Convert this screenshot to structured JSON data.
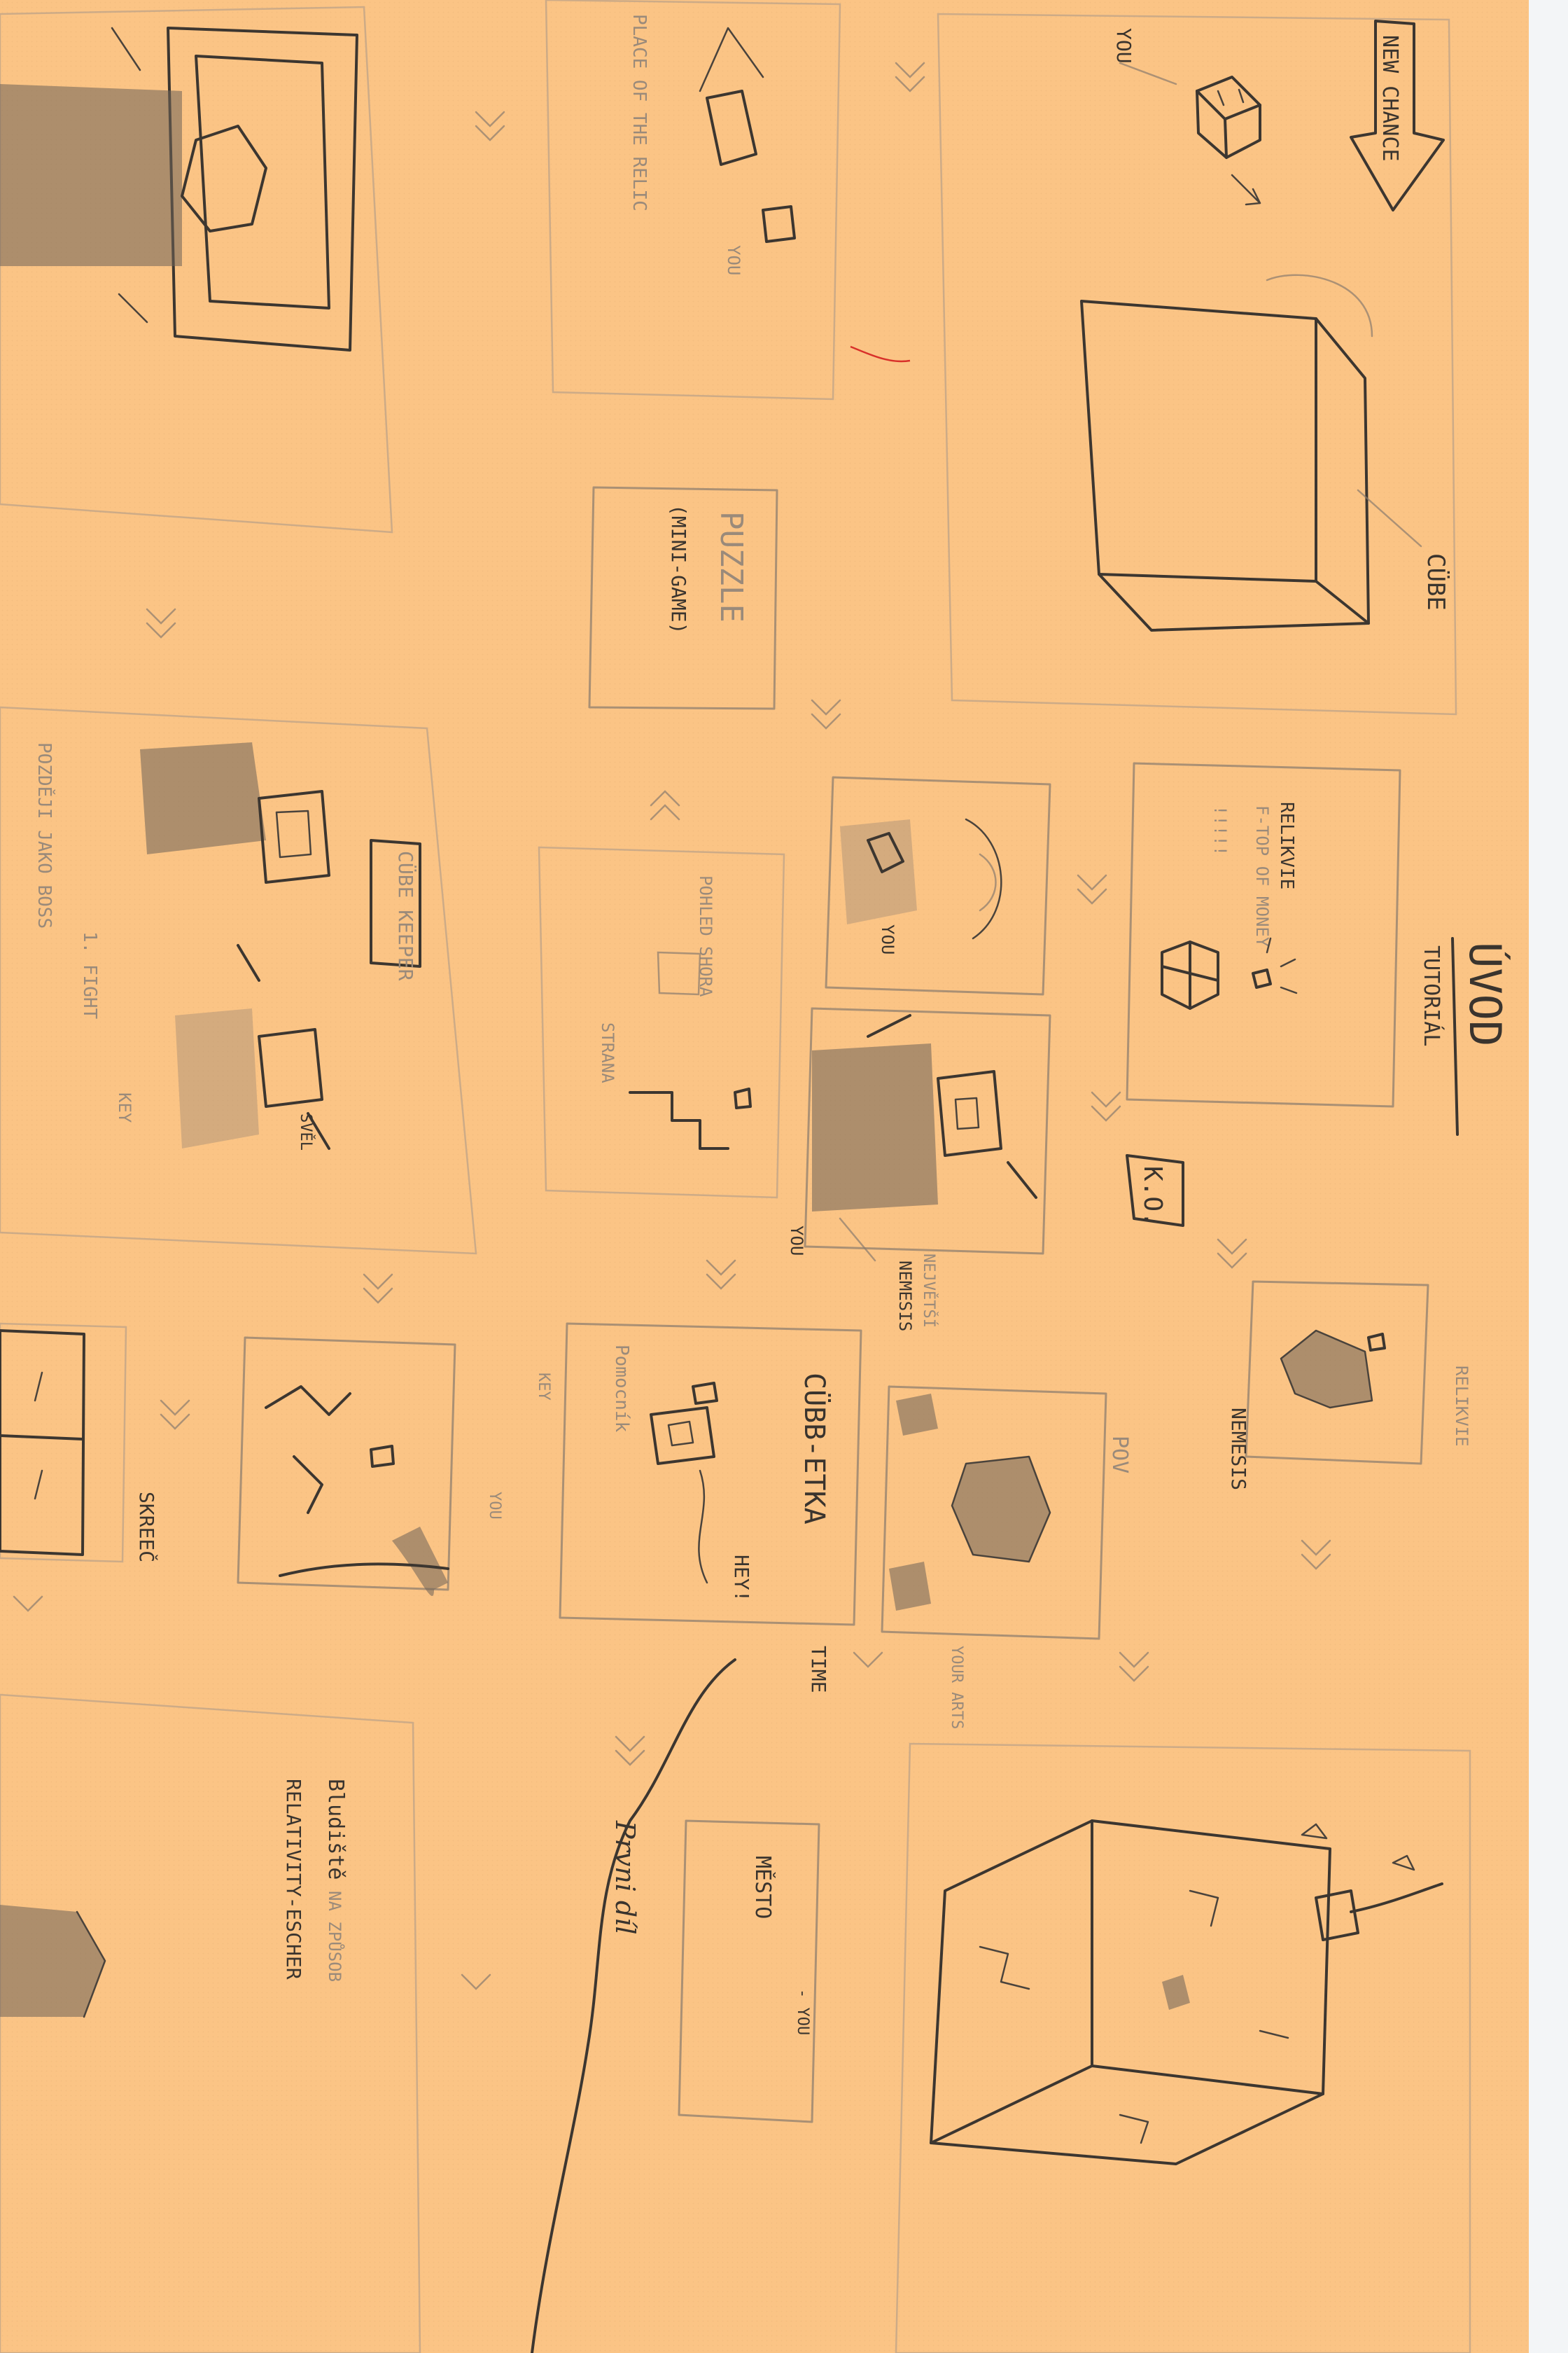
{
  "sheet": {
    "paper_color": "#fbc485",
    "ink_color": "#3a342e"
  },
  "labels": {
    "new_chance": "NEW CHANCE",
    "you": "YOU",
    "cube": "CÜBE",
    "uvod": "ÚVOD",
    "tutorial": "TUTORIÁL",
    "relikvie": "RELIKVIE",
    "f_top_of_money": "F-TOP OF MONEY",
    "exclaims": "!!!!!",
    "ko": "K.O.",
    "nemesis": "NEMESIS",
    "nemesis_small": "NEMESIS",
    "nejvetsi": "NEJVĚTŠÍ",
    "puzzle": "PUZZLE",
    "mini_game": "(MINI-GAME)",
    "place_of_the_relic": "PLACE OF THE RELIC",
    "cube_keeper": "CÜBE KEEPER",
    "first_fight": "1. FIGHT",
    "later_as_boss": "POZDĚJI JAKO BOSS",
    "key": "KEY",
    "svel": "SVĚL",
    "pohled_shora": "POHLED SHORA",
    "strana": "STRANA",
    "cubbetka": "CÜBB-ETKA",
    "hey": "HEY!",
    "pomocnik": "Pomocník",
    "pov": "POV",
    "your_arts": "YOUR ARTS",
    "time": "TIME",
    "mesto": "MĚSTO",
    "you_dash": "- YOU",
    "prvni_dil": "Prvni díl",
    "screen": "SKREEČ",
    "bludiste": "Bludiště",
    "na_zpusob": "NA ZPŮSOB",
    "relativity_escher": "RELATIVITY-ESCHER"
  }
}
